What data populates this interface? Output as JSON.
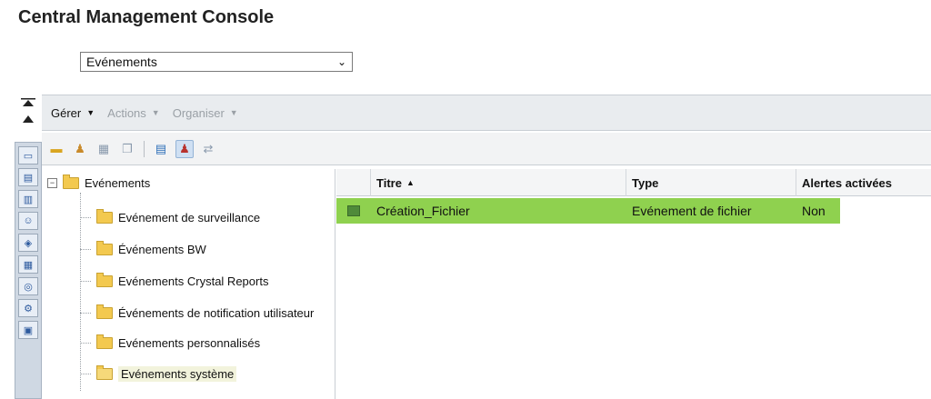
{
  "app": {
    "title": "Central Management Console"
  },
  "nav_select": {
    "value": "Evénements"
  },
  "menu": [
    {
      "label": "Gérer",
      "enabled": true
    },
    {
      "label": "Actions",
      "enabled": false
    },
    {
      "label": "Organiser",
      "enabled": false
    }
  ],
  "toolbar_icons": [
    "new-folder-icon",
    "new-user-icon",
    "calendar-icon",
    "copy-icon",
    "view-icon",
    "user-delete-icon",
    "sync-icon"
  ],
  "rail_icons": [
    "folders-icon",
    "categories-icon",
    "inbox-icon",
    "users-icon",
    "access-levels-icon",
    "servers-icon",
    "databases-icon",
    "federation-icon",
    "connections-icon"
  ],
  "tree": {
    "root": "Evénements",
    "items": [
      "Evénement de surveillance",
      "Événements BW",
      "Evénements Crystal Reports",
      "Événements de notification utilisateur",
      "Evénements personnalisés",
      "Evénements système"
    ],
    "selected_index": 5
  },
  "grid": {
    "columns": {
      "titre": "Titre",
      "type": "Type",
      "alert": "Alertes activées"
    },
    "sort_indicator": "▲",
    "rows": [
      {
        "titre": "Création_Fichier",
        "type": "Evénement de fichier",
        "alert": "Non"
      }
    ],
    "row_highlight_color": "#8fd14f"
  }
}
